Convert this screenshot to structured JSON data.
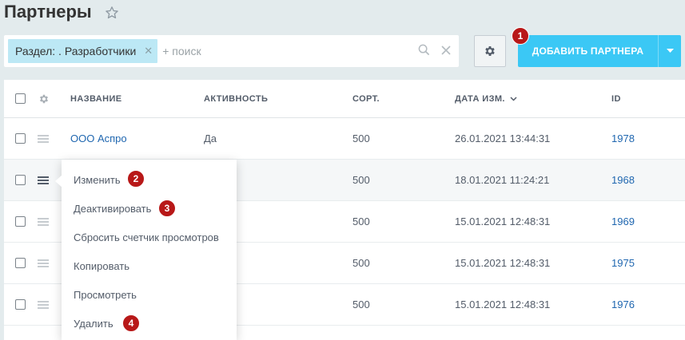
{
  "header": {
    "title": "Партнеры"
  },
  "filter": {
    "chip_label": "Раздел: . Разработчики",
    "placeholder": "+ поиск"
  },
  "toolbar": {
    "add_label": "ДОБАВИТЬ ПАРТНЕРА"
  },
  "badges": {
    "b1": "1",
    "b2": "2",
    "b3": "3",
    "b4": "4"
  },
  "columns": {
    "name": "НАЗВАНИЕ",
    "active": "АКТИВНОСТЬ",
    "sort": "СОРТ.",
    "date": "ДАТА ИЗМ.",
    "id": "ID"
  },
  "rows": [
    {
      "name": "ООО Аспро",
      "active": "Да",
      "sort": "500",
      "date": "26.01.2021 13:44:31",
      "id": "1978"
    },
    {
      "name": "",
      "active": "",
      "sort": "500",
      "date": "18.01.2021 11:24:21",
      "id": "1968"
    },
    {
      "name": "",
      "active": "",
      "sort": "500",
      "date": "15.01.2021 12:48:31",
      "id": "1969"
    },
    {
      "name": "",
      "active": "",
      "sort": "500",
      "date": "15.01.2021 12:48:31",
      "id": "1975"
    },
    {
      "name": "",
      "active": "",
      "sort": "500",
      "date": "15.01.2021 12:48:31",
      "id": "1976"
    }
  ],
  "menu": {
    "edit": "Изменить",
    "deactivate": "Деактивировать",
    "reset": "Сбросить счетчик просмотров",
    "copy": "Копировать",
    "view": "Просмотреть",
    "delete": "Удалить"
  },
  "colors": {
    "accent": "#3bc8f5",
    "badge": "#b81818",
    "link": "#2067b0",
    "chip": "#bce8f5"
  }
}
